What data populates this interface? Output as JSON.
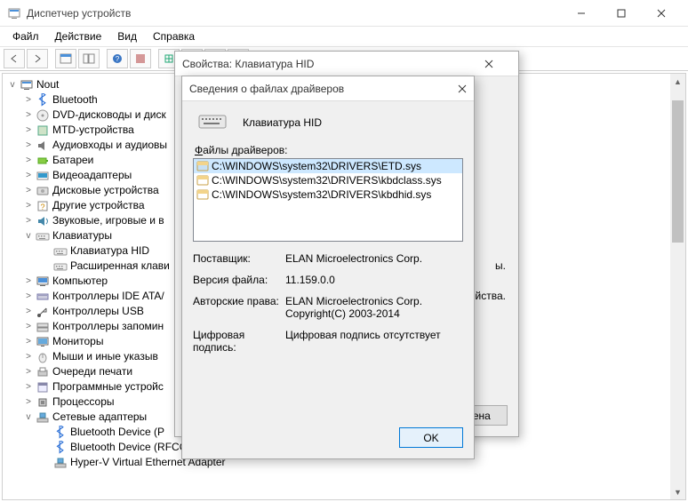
{
  "window": {
    "title": "Диспетчер устройств",
    "menu": [
      "Файл",
      "Действие",
      "Вид",
      "Справка"
    ]
  },
  "tree": {
    "root": "Nout",
    "nodes": [
      {
        "depth": 1,
        "tw": ">",
        "icon": "bt",
        "label": "Bluetooth"
      },
      {
        "depth": 1,
        "tw": ">",
        "icon": "disc",
        "label": "DVD-дисководы и диск"
      },
      {
        "depth": 1,
        "tw": ">",
        "icon": "dev",
        "label": "MTD-устройства"
      },
      {
        "depth": 1,
        "tw": ">",
        "icon": "aud",
        "label": "Аудиовходы и аудиовы"
      },
      {
        "depth": 1,
        "tw": ">",
        "icon": "bat",
        "label": "Батареи"
      },
      {
        "depth": 1,
        "tw": ">",
        "icon": "vid",
        "label": "Видеоадаптеры"
      },
      {
        "depth": 1,
        "tw": ">",
        "icon": "hdd",
        "label": "Дисковые устройства"
      },
      {
        "depth": 1,
        "tw": ">",
        "icon": "oth",
        "label": "Другие устройства"
      },
      {
        "depth": 1,
        "tw": ">",
        "icon": "snd",
        "label": "Звуковые, игровые и в"
      },
      {
        "depth": 1,
        "tw": "v",
        "icon": "kb",
        "label": "Клавиатуры"
      },
      {
        "depth": 2,
        "tw": "",
        "icon": "kb",
        "label": "Клавиатура HID"
      },
      {
        "depth": 2,
        "tw": "",
        "icon": "kb",
        "label": "Расширенная клави"
      },
      {
        "depth": 1,
        "tw": ">",
        "icon": "pc",
        "label": "Компьютер"
      },
      {
        "depth": 1,
        "tw": ">",
        "icon": "ide",
        "label": "Контроллеры IDE ATA/"
      },
      {
        "depth": 1,
        "tw": ">",
        "icon": "usb",
        "label": "Контроллеры USB"
      },
      {
        "depth": 1,
        "tw": ">",
        "icon": "stor",
        "label": "Контроллеры запомин"
      },
      {
        "depth": 1,
        "tw": ">",
        "icon": "mon",
        "label": "Мониторы"
      },
      {
        "depth": 1,
        "tw": ">",
        "icon": "mouse",
        "label": "Мыши и иные указыв"
      },
      {
        "depth": 1,
        "tw": ">",
        "icon": "prn",
        "label": "Очереди печати"
      },
      {
        "depth": 1,
        "tw": ">",
        "icon": "sw",
        "label": "Программные устройс"
      },
      {
        "depth": 1,
        "tw": ">",
        "icon": "cpu",
        "label": "Процессоры"
      },
      {
        "depth": 1,
        "tw": "v",
        "icon": "net",
        "label": "Сетевые адаптеры"
      },
      {
        "depth": 2,
        "tw": "",
        "icon": "bt",
        "label": "Bluetooth Device (P"
      },
      {
        "depth": 2,
        "tw": "",
        "icon": "bt",
        "label": "Bluetooth Device (RFCOMM Protocol TDI)"
      },
      {
        "depth": 2,
        "tw": "",
        "icon": "net",
        "label": "Hyper-V Virtual Ethernet Adapter"
      }
    ]
  },
  "dlg1": {
    "title": "Свойства: Клавиатура HID",
    "frag1": "ы.",
    "frag2": "ойства.",
    "cancel": "тмена"
  },
  "dlg2": {
    "title": "Сведения о файлах драйверов",
    "device": "Клавиатура HID",
    "files_label_pre": "",
    "files_label": "Файлы драйверов:",
    "files": [
      {
        "sel": true,
        "text": "C:\\WINDOWS\\system32\\DRIVERS\\ETD.sys"
      },
      {
        "sel": false,
        "text": "C:\\WINDOWS\\system32\\DRIVERS\\kbdclass.sys"
      },
      {
        "sel": false,
        "text": "C:\\WINDOWS\\system32\\DRIVERS\\kbdhid.sys"
      }
    ],
    "meta": {
      "vendor_label": "Поставщик:",
      "vendor": "ELAN Microelectronics Corp.",
      "version_label": "Версия файла:",
      "version": "11.159.0.0",
      "copyright_label": "Авторские права:",
      "copyright": "ELAN Microelectronics Corp. Copyright(C) 2003-2014",
      "sig_label": "Цифровая подпись:",
      "sig": "Цифровая подпись отсутствует"
    },
    "ok": "OK"
  }
}
